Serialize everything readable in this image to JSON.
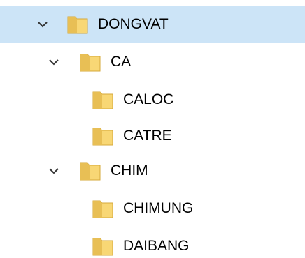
{
  "tree": {
    "items": [
      {
        "label": "DONGVAT",
        "level": 0,
        "expanded": true,
        "selected": true
      },
      {
        "label": "CA",
        "level": 1,
        "expanded": true,
        "selected": false
      },
      {
        "label": "CALOC",
        "level": 2,
        "expanded": null,
        "selected": false
      },
      {
        "label": "CATRE",
        "level": 2,
        "expanded": null,
        "selected": false
      },
      {
        "label": "CHIM",
        "level": 1,
        "expanded": true,
        "selected": false
      },
      {
        "label": "CHIMUNG",
        "level": 2,
        "expanded": null,
        "selected": false
      },
      {
        "label": "DAIBANG",
        "level": 2,
        "expanded": null,
        "selected": false
      }
    ]
  },
  "icons": {
    "expand": "chevron-down-icon",
    "folder": "folder-icon"
  },
  "colors": {
    "selection": "#cce4f7",
    "folder_body": "#f8d775",
    "folder_tab": "#e0b447",
    "chevron": "#333333"
  }
}
